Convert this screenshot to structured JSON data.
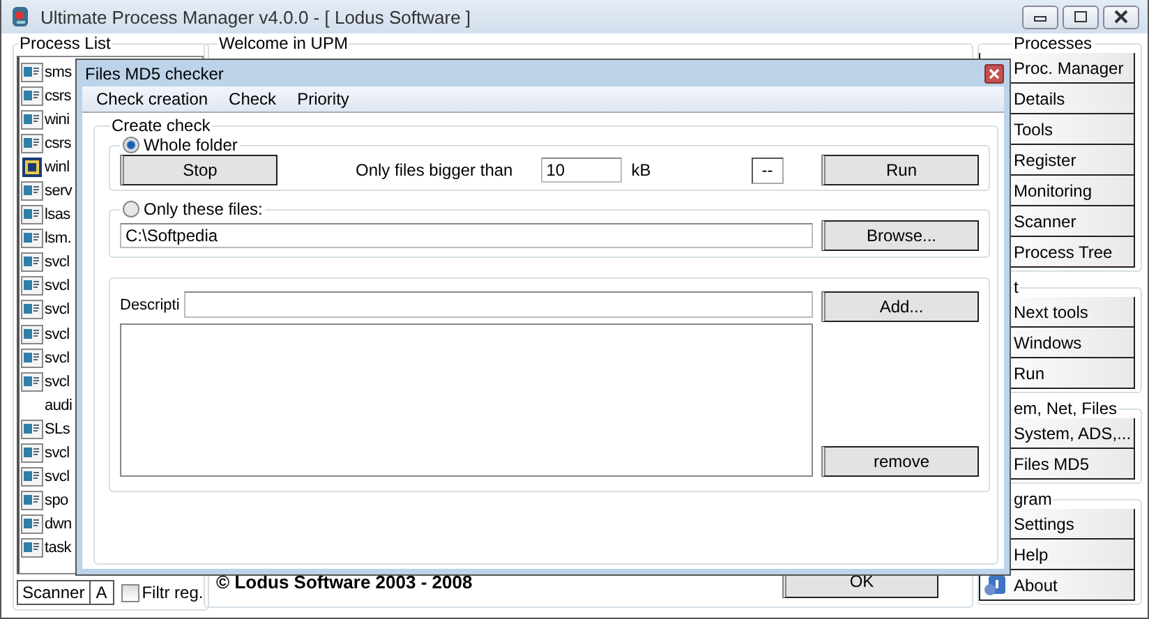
{
  "window": {
    "title": "Ultimate Process Manager v4.0.0 - [ Lodus Software ]"
  },
  "process_list": {
    "title": "Process List",
    "items": [
      {
        "name": "sms",
        "kind": "window"
      },
      {
        "name": "csrs",
        "kind": "window"
      },
      {
        "name": "wini",
        "kind": "window"
      },
      {
        "name": "csrs",
        "kind": "window"
      },
      {
        "name": "winl",
        "kind": "special"
      },
      {
        "name": "serv",
        "kind": "window"
      },
      {
        "name": "lsas",
        "kind": "window"
      },
      {
        "name": "lsm.",
        "kind": "window"
      },
      {
        "name": "svcl",
        "kind": "window"
      },
      {
        "name": "svcl",
        "kind": "window"
      },
      {
        "name": "svcl",
        "kind": "window"
      },
      {
        "name": "svcl",
        "kind": "window"
      },
      {
        "name": "svcl",
        "kind": "window"
      },
      {
        "name": "svcl",
        "kind": "window"
      },
      {
        "name": "audi",
        "kind": "none"
      },
      {
        "name": "SLs",
        "kind": "window"
      },
      {
        "name": "svcl",
        "kind": "window"
      },
      {
        "name": "svcl",
        "kind": "window"
      },
      {
        "name": "spo",
        "kind": "window"
      },
      {
        "name": "dwn",
        "kind": "window"
      },
      {
        "name": "task",
        "kind": "window"
      }
    ]
  },
  "scanner": {
    "label": "Scanner",
    "letter": "A"
  },
  "filter": {
    "label": "Filtr reg.",
    "checked": false
  },
  "welcome": {
    "title": "Welcome in UPM",
    "copyright": "© Lodus Software 2003 - 2008",
    "ok_button": "OK"
  },
  "side_groups": [
    {
      "title": "Processes",
      "buttons": [
        {
          "label": "Proc. Manager",
          "kind": "plain"
        },
        {
          "label": "Details",
          "kind": "plain"
        },
        {
          "label": "Tools",
          "kind": "plain"
        },
        {
          "label": "Register",
          "kind": "plain"
        },
        {
          "label": "Monitoring",
          "kind": "plain"
        },
        {
          "label": "Scanner",
          "kind": "plain"
        },
        {
          "label": "Process Tree",
          "kind": "plain"
        }
      ]
    },
    {
      "title": "t",
      "buttons": [
        {
          "label": "Next tools",
          "kind": "plain"
        },
        {
          "label": "Windows",
          "kind": "plain"
        },
        {
          "label": "Run",
          "kind": "plain"
        }
      ]
    },
    {
      "title": "em, Net, Files",
      "buttons": [
        {
          "label": "System, ADS,...",
          "kind": "plain"
        },
        {
          "label": "Files MD5",
          "kind": "plain"
        }
      ]
    },
    {
      "title": "gram",
      "buttons": [
        {
          "label": "Settings",
          "kind": "plain"
        },
        {
          "label": "Help",
          "kind": "plain"
        },
        {
          "label": "About",
          "kind": "icon"
        }
      ]
    }
  ],
  "dialog": {
    "title": "Files MD5 checker",
    "menu": [
      "Check creation",
      "Check",
      "Priority"
    ],
    "group_title": "Create check",
    "modes": [
      {
        "label": "Whole folder",
        "selected": true
      },
      {
        "label": "Only these files:",
        "selected": false
      }
    ],
    "stop_button": "Stop",
    "size_label": "Only files bigger than",
    "size_value": "10",
    "size_unit": "kB",
    "status": "--",
    "run_button": "Run",
    "path": "C:\\Softpedia",
    "browse_button": "Browse...",
    "description_label": "Descripti",
    "add_button": "Add...",
    "remove_button": "remove"
  }
}
